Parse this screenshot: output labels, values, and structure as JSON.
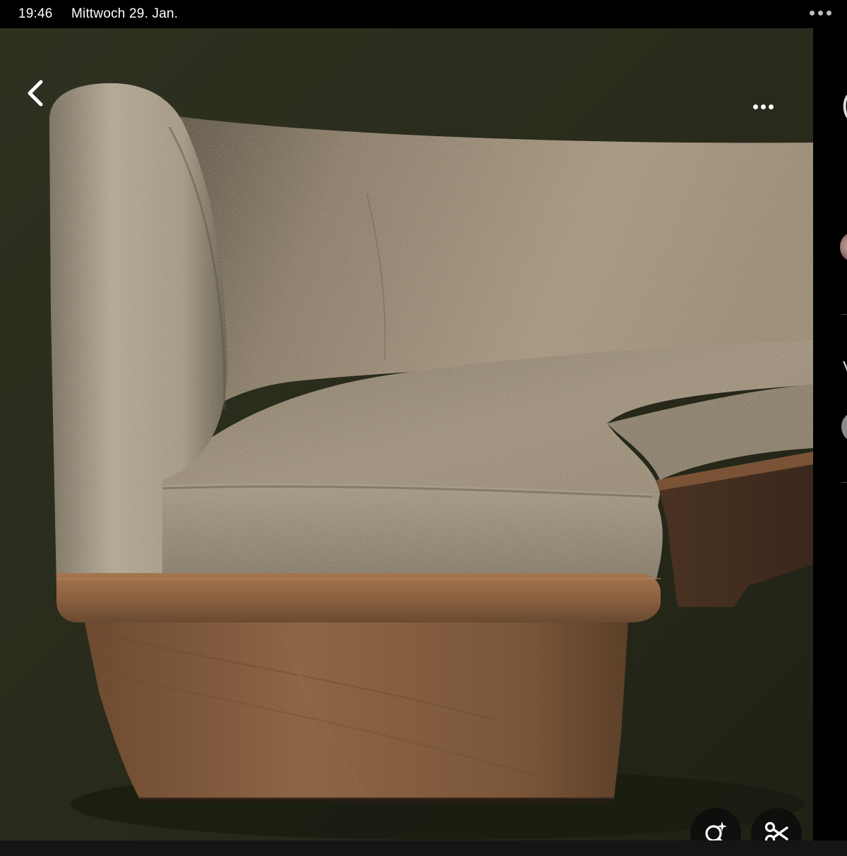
{
  "status_bar": {
    "time": "19:46",
    "date": "Mittwoch 29. Jan."
  },
  "viewer": {
    "photo_subject": "curved upholstered sofa",
    "colors": {
      "background": "#262818",
      "fabric": "#a79a84",
      "wood": "#8a5e3a"
    }
  },
  "icons": {
    "back": "chevron-left-icon",
    "more": "more-dots-icon",
    "visual_lookup": "search-sparkle-icon",
    "cut_out": "scissors-icon"
  }
}
